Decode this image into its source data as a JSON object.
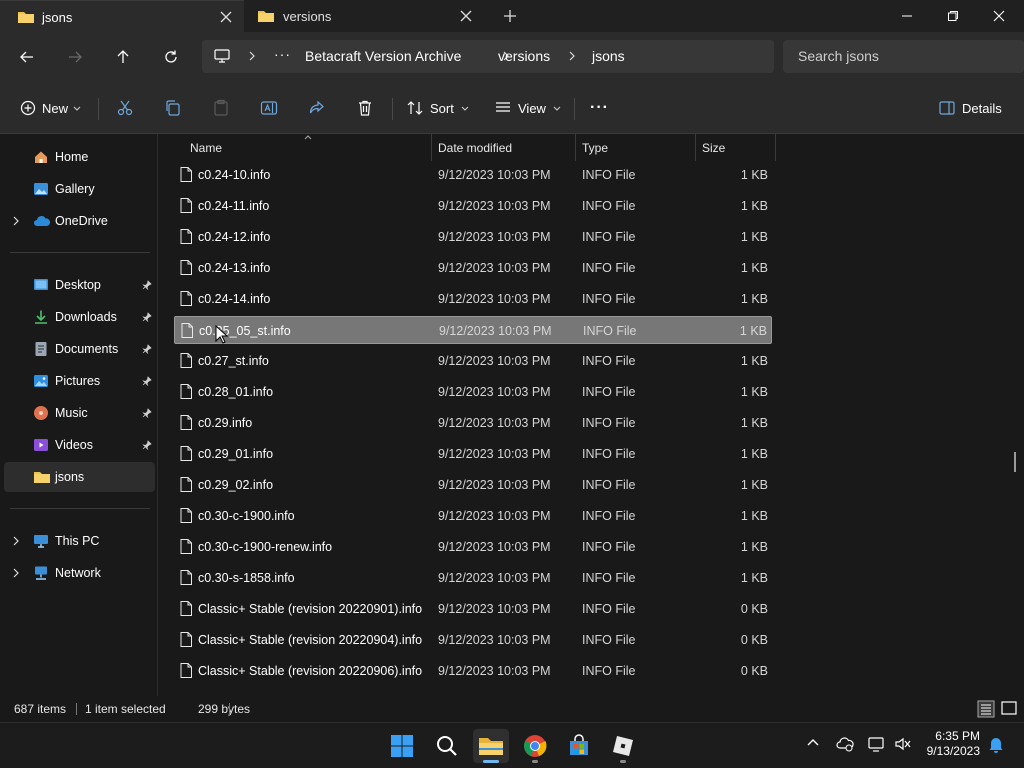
{
  "tabs": [
    {
      "label": "jsons",
      "active": true
    },
    {
      "label": "versions",
      "active": false
    }
  ],
  "breadcrumb": {
    "ellipsis": "···",
    "items": [
      "Betacraft Version Archive",
      "versions",
      "jsons"
    ]
  },
  "search": {
    "placeholder": "Search jsons"
  },
  "toolbar": {
    "new_label": "New",
    "sort_label": "Sort",
    "view_label": "View",
    "more_label": "···",
    "details_label": "Details"
  },
  "sidebar": {
    "top": [
      {
        "label": "Home",
        "icon": "home-icon"
      },
      {
        "label": "Gallery",
        "icon": "gallery-icon"
      },
      {
        "label": "OneDrive",
        "icon": "onedrive-icon",
        "expandable": true
      }
    ],
    "quick": [
      {
        "label": "Desktop",
        "icon": "desktop-icon",
        "pinned": true
      },
      {
        "label": "Downloads",
        "icon": "downloads-icon",
        "pinned": true
      },
      {
        "label": "Documents",
        "icon": "documents-icon",
        "pinned": true
      },
      {
        "label": "Pictures",
        "icon": "pictures-icon",
        "pinned": true
      },
      {
        "label": "Music",
        "icon": "music-icon",
        "pinned": true
      },
      {
        "label": "Videos",
        "icon": "videos-icon",
        "pinned": true
      },
      {
        "label": "jsons",
        "icon": "folder-icon",
        "selected": true
      }
    ],
    "bottom": [
      {
        "label": "This PC",
        "icon": "this-pc-icon",
        "expandable": true
      },
      {
        "label": "Network",
        "icon": "network-icon",
        "expandable": true
      }
    ]
  },
  "columns": {
    "name": "Name",
    "date": "Date modified",
    "type": "Type",
    "size": "Size"
  },
  "files": [
    {
      "name": "c0.24-10.info",
      "date": "9/12/2023 10:03 PM",
      "type": "INFO File",
      "size": "1 KB"
    },
    {
      "name": "c0.24-11.info",
      "date": "9/12/2023 10:03 PM",
      "type": "INFO File",
      "size": "1 KB"
    },
    {
      "name": "c0.24-12.info",
      "date": "9/12/2023 10:03 PM",
      "type": "INFO File",
      "size": "1 KB"
    },
    {
      "name": "c0.24-13.info",
      "date": "9/12/2023 10:03 PM",
      "type": "INFO File",
      "size": "1 KB"
    },
    {
      "name": "c0.24-14.info",
      "date": "9/12/2023 10:03 PM",
      "type": "INFO File",
      "size": "1 KB"
    },
    {
      "name": "c0.25_05_st.info",
      "date": "9/12/2023 10:03 PM",
      "type": "INFO File",
      "size": "1 KB",
      "selected": true
    },
    {
      "name": "c0.27_st.info",
      "date": "9/12/2023 10:03 PM",
      "type": "INFO File",
      "size": "1 KB"
    },
    {
      "name": "c0.28_01.info",
      "date": "9/12/2023 10:03 PM",
      "type": "INFO File",
      "size": "1 KB"
    },
    {
      "name": "c0.29.info",
      "date": "9/12/2023 10:03 PM",
      "type": "INFO File",
      "size": "1 KB"
    },
    {
      "name": "c0.29_01.info",
      "date": "9/12/2023 10:03 PM",
      "type": "INFO File",
      "size": "1 KB"
    },
    {
      "name": "c0.29_02.info",
      "date": "9/12/2023 10:03 PM",
      "type": "INFO File",
      "size": "1 KB"
    },
    {
      "name": "c0.30-c-1900.info",
      "date": "9/12/2023 10:03 PM",
      "type": "INFO File",
      "size": "1 KB"
    },
    {
      "name": "c0.30-c-1900-renew.info",
      "date": "9/12/2023 10:03 PM",
      "type": "INFO File",
      "size": "1 KB"
    },
    {
      "name": "c0.30-s-1858.info",
      "date": "9/12/2023 10:03 PM",
      "type": "INFO File",
      "size": "1 KB"
    },
    {
      "name": "Classic+ Stable (revision 20220901).info",
      "date": "9/12/2023 10:03 PM",
      "type": "INFO File",
      "size": "0 KB"
    },
    {
      "name": "Classic+ Stable (revision 20220904).info",
      "date": "9/12/2023 10:03 PM",
      "type": "INFO File",
      "size": "0 KB"
    },
    {
      "name": "Classic+ Stable (revision 20220906).info",
      "date": "9/12/2023 10:03 PM",
      "type": "INFO File",
      "size": "0 KB"
    }
  ],
  "status": {
    "items": "687 items",
    "selected": "1 item selected",
    "bytes": "299 bytes"
  },
  "clock": {
    "time": "6:35 PM",
    "date": "9/13/2023"
  },
  "colors": {
    "accent": "#0078d4",
    "folder": "#f0c14b",
    "selection": "#777777"
  }
}
